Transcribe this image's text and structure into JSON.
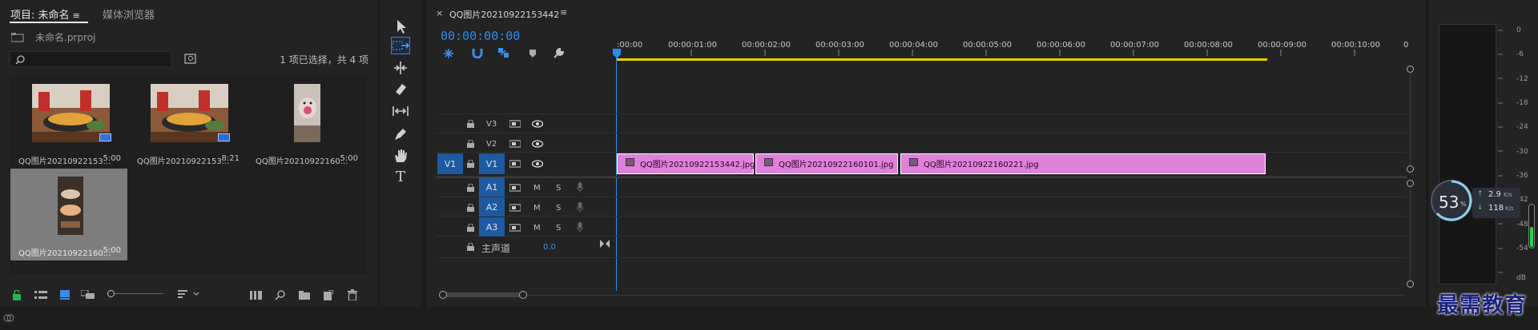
{
  "project_panel": {
    "tab_project": "项目: 未命名",
    "tab_media_browser": "媒体浏览器",
    "project_file": "未命名.prproj",
    "search_value": "",
    "selection_status": "1 项已选择，共 4 项",
    "items": [
      {
        "name": "QQ图片20210922153...",
        "duration": "5:00",
        "selected": false
      },
      {
        "name": "QQ图片20210922153...",
        "duration": "8:21",
        "selected": false
      },
      {
        "name": "QQ图片20210922160...",
        "duration": "5:00",
        "selected": false
      },
      {
        "name": "QQ图片20210922160...",
        "duration": "5:00",
        "selected": true
      }
    ]
  },
  "timeline": {
    "sequence_name": "QQ图片20210922153442",
    "timecode": "00:00:00:00",
    "ruler_labels": [
      ":00:00",
      "00:00:01:00",
      "00:00:02:00",
      "00:00:03:00",
      "00:00:04:00",
      "00:00:05:00",
      "00:00:06:00",
      "00:00:07:00",
      "00:00:08:00",
      "00:00:09:00",
      "00:00:10:00",
      "0"
    ],
    "video_tracks": [
      "V3",
      "V2",
      "V1"
    ],
    "source_video": "V1",
    "audio_tracks": [
      "A1",
      "A2",
      "A3"
    ],
    "audio_mute_label": "M",
    "audio_solo_label": "S",
    "master_label": "主声道",
    "master_value": "0.0",
    "clips": [
      {
        "name": "QQ图片20210922153442.jpg"
      },
      {
        "name": "QQ图片20210922160101.jpg"
      },
      {
        "name": "QQ图片20210922160221.jpg"
      }
    ]
  },
  "meter": {
    "db_labels": [
      "0",
      "-6",
      "-12",
      "-18",
      "-24",
      "-30",
      "-36",
      "-42",
      "-48",
      "-54",
      "dB"
    ],
    "cpu_percent": "53",
    "cpu_unit": "%",
    "upload_speed": "2.9",
    "download_speed": "118",
    "speed_unit": "K/s"
  },
  "watermark": "最需教育",
  "colors": {
    "accent_blue": "#1f5aa0",
    "clip_pink": "#de82d9",
    "timecode_blue": "#2d8ceb",
    "work_area_yellow": "#e6d200"
  }
}
